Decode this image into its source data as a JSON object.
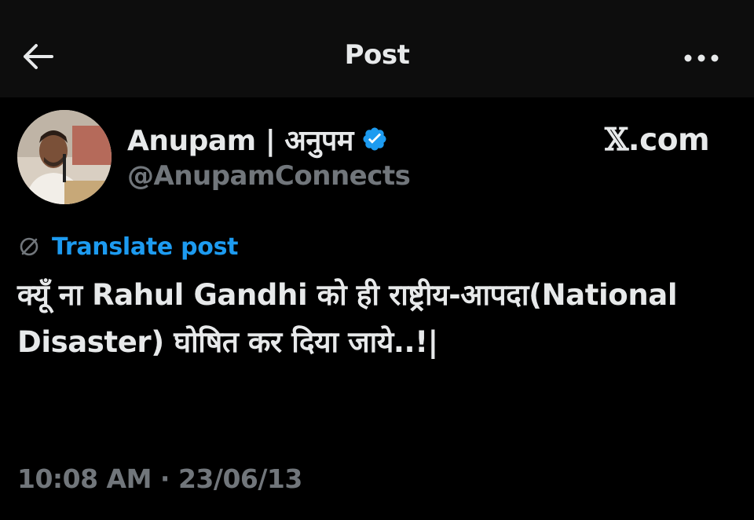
{
  "header": {
    "title": "Post",
    "back_icon": "arrow-left-icon",
    "more_icon": "more-horizontal-icon"
  },
  "author": {
    "display_name": "Anupam | अनुपम",
    "handle": "@AnupamConnects",
    "verified": true,
    "verified_color": "#1d9bf0"
  },
  "watermark": {
    "x_glyph": "𝕏",
    "domain": ".com"
  },
  "translate": {
    "label": "Translate post",
    "icon": "globe-icon",
    "color": "#1d9bf0"
  },
  "post": {
    "text": "क्यूँ ना Rahul Gandhi को ही राष्ट्रीय-आपदा(National Disaster) घोषित कर दिया जाये..!|"
  },
  "meta": {
    "time": "10:08 AM",
    "separator": "·",
    "date": "23/06/13"
  },
  "colors": {
    "background": "#000000",
    "header_background": "#0d0d0d",
    "text_primary": "#e7e9ea",
    "text_secondary": "#71767b",
    "accent": "#1d9bf0"
  }
}
